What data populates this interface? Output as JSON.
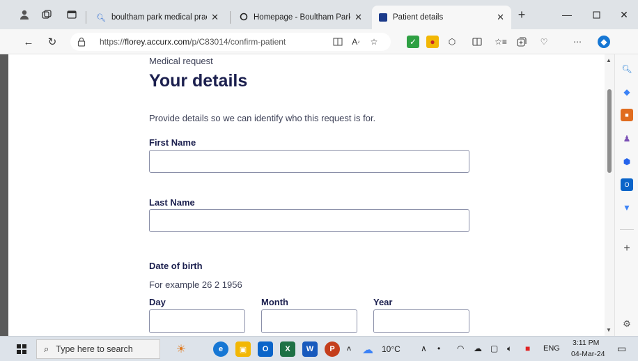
{
  "browser": {
    "tabs": [
      {
        "title": "boultham park medical practice",
        "active": false
      },
      {
        "title": "Homepage - Boultham Park Med",
        "active": false
      },
      {
        "title": "Patient details",
        "active": true
      }
    ],
    "url_prefix": "https://",
    "url_domain": "florey.accurx.com",
    "url_path": "/p/C83014/confirm-patient"
  },
  "page": {
    "eyebrow": "Medical request",
    "heading": "Your details",
    "intro": "Provide details so we can identify who this request is for.",
    "first_name_label": "First Name",
    "first_name_value": "",
    "last_name_label": "Last Name",
    "last_name_value": "",
    "dob_label": "Date of birth",
    "dob_hint": "For example 26 2 1956",
    "day_label": "Day",
    "month_label": "Month",
    "year_label": "Year",
    "day_value": "",
    "month_value": "",
    "year_value": ""
  },
  "taskbar": {
    "search_placeholder": "Type here to search",
    "weather": "10°C",
    "language": "ENG",
    "time": "3:11 PM",
    "date": "04-Mar-24"
  },
  "colors": {
    "heading": "#1b1f4e",
    "body_text": "#3d4157",
    "input_border": "#8a8fa8"
  }
}
